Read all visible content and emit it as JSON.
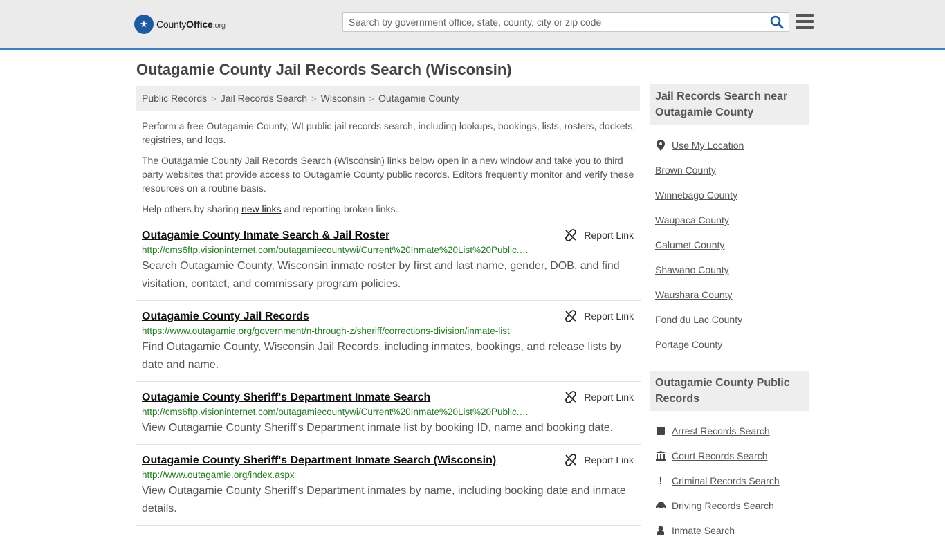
{
  "header": {
    "logo_brand": "County",
    "logo_brand_bold": "Office",
    "logo_tld": ".org",
    "search_placeholder": "Search by government office, state, county, city or zip code"
  },
  "page": {
    "title": "Outagamie County Jail Records Search (Wisconsin)"
  },
  "breadcrumb": [
    "Public Records",
    "Jail Records Search",
    "Wisconsin",
    "Outagamie County"
  ],
  "intro": {
    "p1": "Perform a free Outagamie County, WI public jail records search, including lookups, bookings, lists, rosters, dockets, registries, and logs.",
    "p2": "The Outagamie County Jail Records Search (Wisconsin) links below open in a new window and take you to third party websites that provide access to Outagamie County public records. Editors frequently monitor and verify these resources on a routine basis.",
    "p3_before": "Help others by sharing ",
    "p3_link": "new links",
    "p3_after": " and reporting broken links."
  },
  "report_label": "Report Link",
  "results": [
    {
      "title": "Outagamie County Inmate Search & Jail Roster",
      "url": "http://cms6ftp.visioninternet.com/outagamiecountywi/Current%20Inmate%20List%20Public.…",
      "desc": "Search Outagamie County, Wisconsin inmate roster by first and last name, gender, DOB, and find visitation, contact, and commissary program policies."
    },
    {
      "title": "Outagamie County Jail Records",
      "url": "https://www.outagamie.org/government/n-through-z/sheriff/corrections-division/inmate-list",
      "desc": "Find Outagamie County, Wisconsin Jail Records, including inmates, bookings, and release lists by date and name."
    },
    {
      "title": "Outagamie County Sheriff's Department Inmate Search",
      "url": "http://cms6ftp.visioninternet.com/outagamiecountywi/Current%20Inmate%20List%20Public.…",
      "desc": "View Outagamie County Sheriff's Department inmate list by booking ID, name and booking date."
    },
    {
      "title": "Outagamie County Sheriff's Department Inmate Search (Wisconsin)",
      "url": "http://www.outagamie.org/index.aspx",
      "desc": "View Outagamie County Sheriff's Department inmates by name, including booking date and inmate details."
    }
  ],
  "sidebar": {
    "nearby_title": "Jail Records Search near Outagamie County",
    "use_location": "Use My Location",
    "nearby": [
      "Brown County",
      "Winnebago County",
      "Waupaca County",
      "Calumet County",
      "Shawano County",
      "Waushara County",
      "Fond du Lac County",
      "Portage County"
    ],
    "public_title": "Outagamie County Public Records",
    "public_records": [
      {
        "label": "Arrest Records Search",
        "icon": "square-icon"
      },
      {
        "label": "Court Records Search",
        "icon": "courthouse-icon"
      },
      {
        "label": "Criminal Records Search",
        "icon": "exclamation-icon"
      },
      {
        "label": "Driving Records Search",
        "icon": "car-icon"
      },
      {
        "label": "Inmate Search",
        "icon": "inmate-icon"
      }
    ]
  }
}
